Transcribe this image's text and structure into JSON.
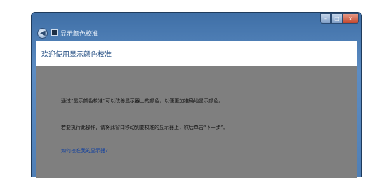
{
  "window": {
    "title": "显示颜色校准",
    "controls": {
      "minimize": "–",
      "maximize": "□",
      "close": "x"
    }
  },
  "header": {
    "title": "欢迎使用显示颜色校准"
  },
  "content": {
    "line1": "通过“显示颜色校准”可以改善显示器上的颜色，以便更加准确地显示颜色。",
    "line2": "若要执行此操作，请将此窗口移动到要校准的显示器上，然后单击“下一步”。",
    "help_link": "如何校准我的显示器?"
  },
  "icons": {
    "back": "back-arrow-icon",
    "app": "app-icon"
  }
}
